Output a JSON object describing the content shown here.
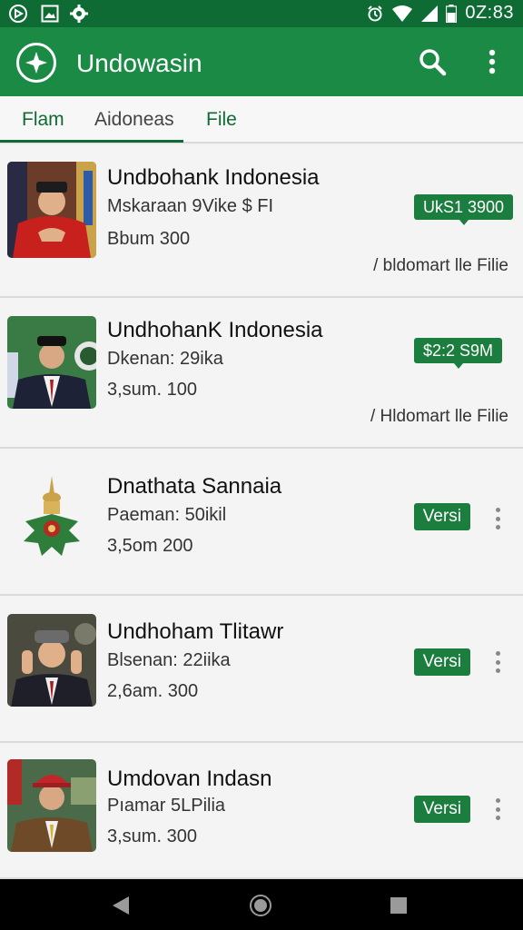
{
  "status_bar": {
    "time": "0Z:83",
    "left_icons": [
      "compass-icon",
      "image-icon",
      "gear-icon"
    ],
    "right_icons": [
      "alarm-icon",
      "wifi-icon",
      "signal-icon",
      "battery-icon"
    ]
  },
  "app_bar": {
    "title": "Undowasin",
    "logo_icon": "compass-star-icon",
    "actions": [
      "search-icon",
      "more-vert-icon"
    ]
  },
  "tabs": [
    {
      "label": "Flam",
      "selected": true
    },
    {
      "label": "Aidoneas",
      "selected": true
    },
    {
      "label": "File",
      "selected": false
    }
  ],
  "items": [
    {
      "title": "Undbohank Indonesia",
      "subtitle": "Mskaraan 9Vike  $ FI",
      "meta": "Bbum  300",
      "price": "UkS1 3900",
      "link": "/ bldomart lle Filie",
      "thumb": "person-red-jacket"
    },
    {
      "title": "UndhohanK Indonesia",
      "subtitle": "Dkenan: 29ika",
      "meta": "3,sum. 100",
      "price": "$2:2 S9M",
      "link": "/ Hldomart lle Filie",
      "thumb": "person-dark-suit"
    },
    {
      "title": "Dnathata Sannaia",
      "subtitle": "Paeman: 50ikil",
      "meta": "3,5om  200",
      "badge": "Versi",
      "thumb": "monument-emblem"
    },
    {
      "title": "Undhoham Tlitawr",
      "subtitle": "Blsenan: 22iika",
      "meta": "2,6am. 300",
      "badge": "Versi",
      "thumb": "person-grey-cap"
    },
    {
      "title": "Umdovan Indasn",
      "subtitle": "Pıamar 5LPilia",
      "meta": "3,sum. 300",
      "badge": "Versi",
      "thumb": "person-red-cap"
    }
  ],
  "nav_bar": [
    "back-icon",
    "home-icon",
    "recents-icon"
  ],
  "colors": {
    "primary": "#1a8a45",
    "primary_dark": "#0d6b33",
    "badge": "#1b7e3e",
    "background": "#f1f1f1"
  }
}
